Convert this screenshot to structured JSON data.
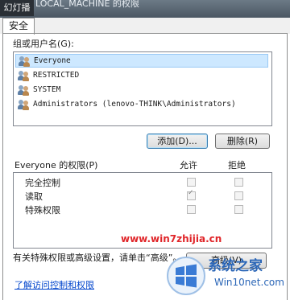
{
  "window": {
    "title": "LOCAL_MACHINE 的权限",
    "slideshow_label": "幻灯播放"
  },
  "tabs": [
    {
      "label": "安全"
    }
  ],
  "users_group": {
    "label": "组或用户名(G):",
    "items": [
      {
        "name": "Everyone",
        "selected": true
      },
      {
        "name": "RESTRICTED",
        "selected": false
      },
      {
        "name": "SYSTEM",
        "selected": false
      },
      {
        "name": "Administrators (lenovo-THINK\\Administrators)",
        "selected": false
      }
    ]
  },
  "buttons": {
    "add": "添加(D)...",
    "remove": "删除(R)",
    "advanced": "高级(V)"
  },
  "permissions": {
    "label": "Everyone 的权限(P)",
    "allow_header": "允许",
    "deny_header": "拒绝",
    "rows": [
      {
        "name": "完全控制",
        "allow": false,
        "deny": false
      },
      {
        "name": "读取",
        "allow": true,
        "deny": false
      },
      {
        "name": "特殊权限",
        "allow": false,
        "deny": false
      }
    ]
  },
  "note": "有关特殊权限或高级设置，请单击“高级”。",
  "link": "了解访问控制和权限",
  "watermark": {
    "site": "www.win7zhijia.cn",
    "logo_main": "系统之家",
    "logo_sub": "Win10net.com"
  },
  "colors": {
    "selection": "#cde8ff",
    "link": "#0044cc",
    "watermark_red": "#e0262a",
    "logo_blue": "#2b66b7"
  }
}
